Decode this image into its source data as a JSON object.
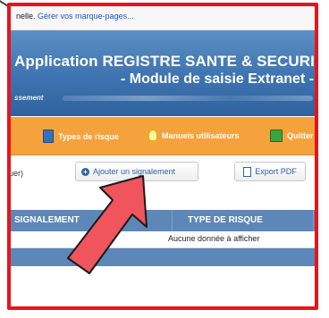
{
  "bookmarks": {
    "prefix": "nelle.",
    "link": "Gérer vos marque-pages..."
  },
  "banner": {
    "title_line1": "Application REGISTRE SANTE & SECURITE",
    "title_line2": "- Module de saisie Extranet -",
    "subtitle": "ssement"
  },
  "menu": {
    "items": [
      {
        "label": "Types de risque",
        "icon": "book-icon"
      },
      {
        "label": "Manuels utilisateurs",
        "icon": "lightbulb-icon"
      },
      {
        "label": "Quitter",
        "icon": "exit-icon"
      }
    ]
  },
  "toolbar": {
    "fragment": "uer)",
    "add_label": "Ajouter un signalement",
    "export_label": "Export PDF"
  },
  "table": {
    "columns": [
      "SIGNALEMENT",
      "TYPE DE RISQUE"
    ],
    "empty_message": "Aucune donnée à afficher"
  },
  "colors": {
    "highlight_border": "#e8141c",
    "banner_blue": "#3d73b0",
    "menu_orange": "#f6a23c",
    "table_header": "#5d87b8",
    "arrow": "#f0545c"
  }
}
